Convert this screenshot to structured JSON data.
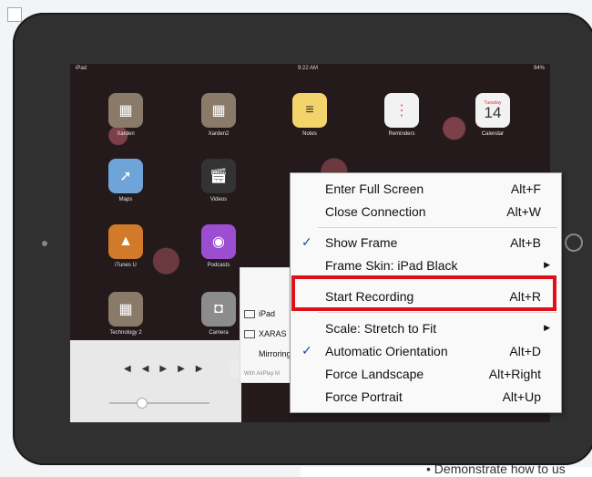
{
  "status_bar": {
    "carrier": "iPad",
    "time": "9:22 AM",
    "battery": "94%"
  },
  "apps": [
    {
      "label": "Xarden",
      "icon": "folder-grid-icon",
      "color": "#8a7a6a"
    },
    {
      "label": "Xarden2",
      "icon": "folder-grid-icon",
      "color": "#8a7a6a"
    },
    {
      "label": "Notes",
      "icon": "notes-icon",
      "color": "#f3d46a"
    },
    {
      "label": "Reminders",
      "icon": "reminders-icon",
      "color": "#f2f2f2"
    },
    {
      "label": "Calendar",
      "icon": "calendar-icon",
      "color": "#f2f2f2",
      "day_name": "Tuesday",
      "day": "14"
    },
    {
      "label": "Maps",
      "icon": "maps-icon",
      "color": "#6fa4d8"
    },
    {
      "label": "Videos",
      "icon": "clapper-icon",
      "color": "#333333"
    },
    {
      "label": "iTunes U",
      "icon": "graduation-cap-icon",
      "color": "#d07a2a"
    },
    {
      "label": "Podcasts",
      "icon": "podcast-icon",
      "color": "#9b4fd0"
    },
    {
      "label": "Technology 2",
      "icon": "folder-grid-icon",
      "color": "#8a7a6a"
    },
    {
      "label": "Camera",
      "icon": "camera-icon",
      "color": "#8c8c8c"
    }
  ],
  "airplay_panel": {
    "items": [
      "iPad",
      "XARAS",
      "Mirroring"
    ],
    "footer": "With AirPlay M"
  },
  "context_menu": {
    "items": [
      {
        "label": "Enter Full Screen",
        "shortcut": "Alt+F",
        "checked": false,
        "submenu": false
      },
      {
        "label": "Close Connection",
        "shortcut": "Alt+W",
        "checked": false,
        "submenu": false
      },
      {
        "label": "Show Frame",
        "shortcut": "Alt+B",
        "checked": true,
        "submenu": false
      },
      {
        "label": "Frame Skin: iPad Black",
        "shortcut": "",
        "checked": false,
        "submenu": true
      },
      {
        "label": "Start Recording",
        "shortcut": "Alt+R",
        "checked": false,
        "submenu": false,
        "highlighted": true
      },
      {
        "label": "Scale: Stretch to Fit",
        "shortcut": "",
        "checked": false,
        "submenu": true
      },
      {
        "label": "Automatic Orientation",
        "shortcut": "Alt+D",
        "checked": true,
        "submenu": false
      },
      {
        "label": "Force Landscape",
        "shortcut": "Alt+Right",
        "checked": false,
        "submenu": false
      },
      {
        "label": "Force Portrait",
        "shortcut": "Alt+Up",
        "checked": false,
        "submenu": false
      }
    ]
  },
  "document": {
    "bullet_text": "Demonstrate how to us"
  },
  "highlight_color": "#e0101a",
  "check_glyph": "✓",
  "submenu_glyph": "▶"
}
